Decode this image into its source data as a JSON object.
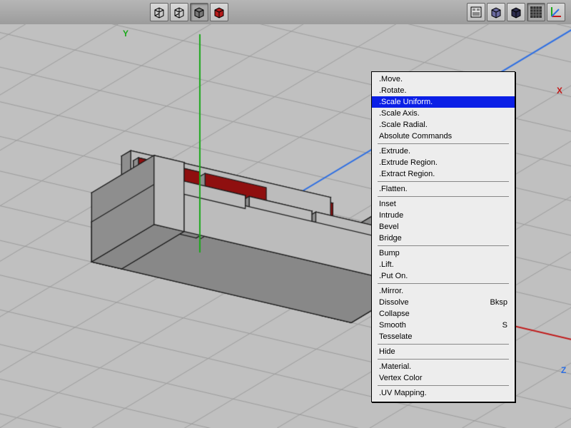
{
  "toolbar": {
    "mode_group": [
      {
        "name": "mode-wire-cube-icon",
        "color": "#3b2fa8"
      },
      {
        "name": "mode-shaded-wire-icon",
        "color": "#3b2fa8"
      },
      {
        "name": "mode-shaded-gray-icon",
        "color": "#777777",
        "active": true
      },
      {
        "name": "mode-shaded-red-icon",
        "color": "#b71c1c"
      }
    ],
    "right_group": [
      {
        "name": "panel-settings-icon",
        "kind": "panel"
      },
      {
        "name": "light-cube-icon",
        "color": "#6a6a9f"
      },
      {
        "name": "dark-cube-icon",
        "color": "#2c2c4d"
      },
      {
        "name": "grid-icon",
        "kind": "grid",
        "active": true
      },
      {
        "name": "axis-icon",
        "kind": "axis"
      }
    ]
  },
  "viewport": {
    "axis_labels": {
      "x": "X",
      "y": "Y",
      "z": "Z"
    },
    "axis_colors": {
      "x": "#c21818",
      "y": "#1aa81a",
      "z": "#2e6fe3"
    },
    "grid_color": "#7a7a7a",
    "background": "#c0c0c0",
    "object_fill": "#bfbfbf",
    "object_stroke": "#1a1a1a",
    "selected_face_fill": "#b31515"
  },
  "menu": {
    "highlight_index": 2,
    "groups": [
      {
        "items": [
          {
            "label": ".Move."
          },
          {
            "label": ".Rotate."
          },
          {
            "label": ".Scale Uniform."
          },
          {
            "label": ".Scale Axis."
          },
          {
            "label": ".Scale Radial."
          },
          {
            "label": "Absolute Commands"
          }
        ]
      },
      {
        "items": [
          {
            "label": ".Extrude."
          },
          {
            "label": ".Extrude Region."
          },
          {
            "label": ".Extract Region."
          }
        ]
      },
      {
        "items": [
          {
            "label": ".Flatten."
          }
        ]
      },
      {
        "items": [
          {
            "label": "Inset"
          },
          {
            "label": "Intrude"
          },
          {
            "label": "Bevel"
          },
          {
            "label": "Bridge"
          }
        ]
      },
      {
        "items": [
          {
            "label": "Bump"
          },
          {
            "label": ".Lift."
          },
          {
            "label": ".Put On."
          }
        ]
      },
      {
        "items": [
          {
            "label": ".Mirror."
          },
          {
            "label": "Dissolve",
            "shortcut": "Bksp"
          },
          {
            "label": "Collapse"
          },
          {
            "label": "Smooth",
            "shortcut": "S"
          },
          {
            "label": "Tesselate"
          }
        ]
      },
      {
        "items": [
          {
            "label": "Hide"
          }
        ]
      },
      {
        "items": [
          {
            "label": ".Material."
          },
          {
            "label": "Vertex Color"
          }
        ]
      },
      {
        "items": [
          {
            "label": ".UV Mapping."
          }
        ]
      }
    ]
  }
}
